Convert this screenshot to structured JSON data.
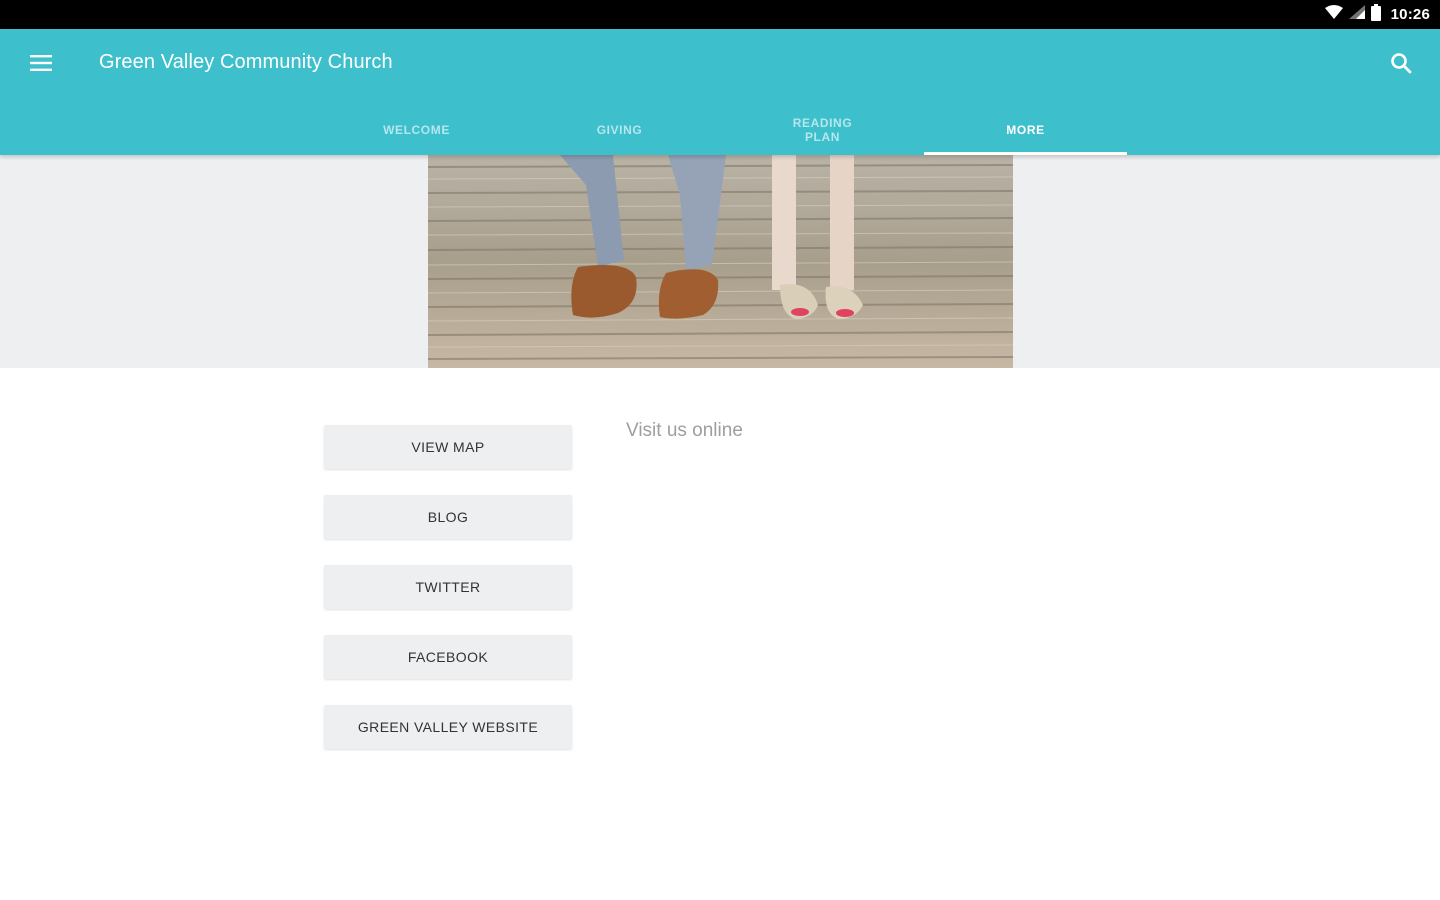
{
  "status_bar": {
    "time": "10:26",
    "icons": [
      "wifi-icon",
      "signal-icon",
      "battery-icon"
    ]
  },
  "app_bar": {
    "title": "Green Valley Community Church",
    "menu_icon": "menu-icon",
    "search_icon": "search-icon",
    "background_color": "#3dbfcc"
  },
  "tabs": [
    {
      "label": "WELCOME",
      "active": false
    },
    {
      "label": "GIVING",
      "active": false
    },
    {
      "label": "READING\nPLAN",
      "active": false
    },
    {
      "label": "MORE",
      "active": true
    }
  ],
  "hero": {
    "image": "hero-photo-feet-on-boardwalk"
  },
  "buttons": [
    {
      "label": "VIEW MAP"
    },
    {
      "label": "BLOG"
    },
    {
      "label": "TWITTER"
    },
    {
      "label": "FACEBOOK"
    },
    {
      "label": "GREEN VALLEY WEBSITE"
    }
  ],
  "content": {
    "visit_text": "Visit us online"
  }
}
